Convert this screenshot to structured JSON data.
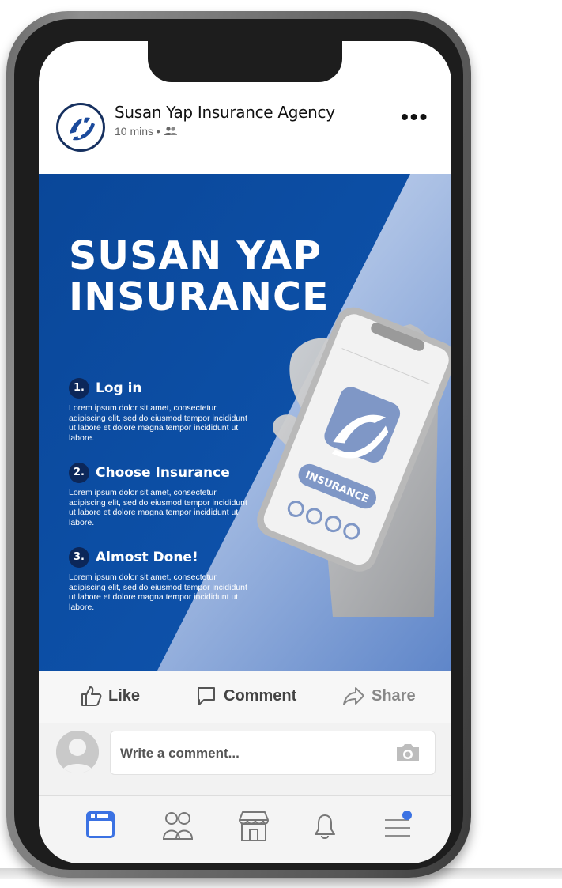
{
  "post": {
    "page_name": "Susan Yap Insurance Agency",
    "time": "10 mins",
    "privacy_separator": "•",
    "more_label": "•••"
  },
  "ad": {
    "title_line1": "SUSAN YAP",
    "title_line2": "INSURANCE",
    "phone_badge": "INSURANCE",
    "steps": [
      {
        "num": "1.",
        "title": "Log in",
        "body": "Lorem ipsum dolor sit amet, consectetur adipiscing elit, sed do eiusmod tempor incididunt ut labore et dolore magna tempor incididunt ut labore."
      },
      {
        "num": "2.",
        "title": "Choose Insurance",
        "body": "Lorem ipsum dolor sit amet, consectetur adipiscing elit, sed do eiusmod tempor incididunt ut labore et dolore magna tempor incididunt ut labore."
      },
      {
        "num": "3.",
        "title": "Almost Done!",
        "body": "Lorem ipsum dolor sit amet, consectetur adipiscing elit, sed do eiusmod tempor incididunt ut labore et dolore magna tempor incididunt ut labore."
      }
    ],
    "colors": {
      "primary": "#0b4a9e",
      "accent": "#8faad8"
    }
  },
  "actions": {
    "like": "Like",
    "comment": "Comment",
    "share": "Share"
  },
  "comment_box": {
    "placeholder": "Write a comment..."
  },
  "tabs": [
    "news-feed-icon",
    "friends-icon",
    "marketplace-icon",
    "notifications-icon",
    "menu-icon"
  ],
  "colors": {
    "tab_active": "#3b72e3",
    "tab_inactive": "#8e8e8e"
  }
}
